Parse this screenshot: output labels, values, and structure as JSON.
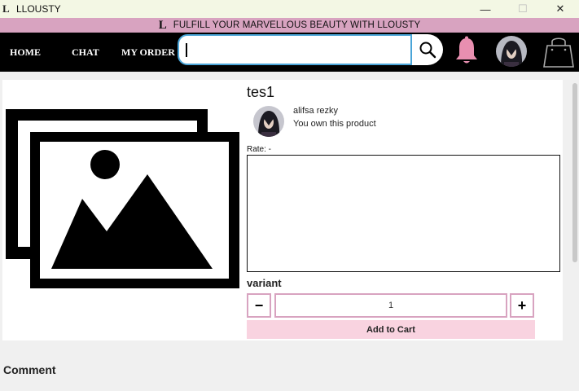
{
  "window": {
    "app_icon": "L",
    "title": "LLOUSTY",
    "minimize_glyph": "—",
    "maximize_glyph": "☐",
    "close_glyph": "✕"
  },
  "banner": {
    "logo": "L",
    "slogan": "FULFILL YOUR MARVELLOUS BEAUTY WITH LLOUSTY",
    "color": "#d8a3c0"
  },
  "nav": {
    "home": "HOME",
    "chat": "CHAT",
    "my_order": "MY ORDER",
    "search_value": "",
    "search_icon": "search-icon",
    "bell_icon": "bell-icon",
    "bell_color": "#e88fb0",
    "avatar": "user-avatar",
    "bag_icon": "shopping-bag-icon"
  },
  "product": {
    "title": "tes1",
    "image_icon": "image-placeholder-icon",
    "seller_name": "alifsa rezky",
    "seller_status": "You own this product",
    "rate_label": "Rate: -",
    "description": "",
    "variant_label": "variant",
    "quantity": "1",
    "minus_label": "−",
    "plus_label": "+",
    "add_to_cart_label": "Add to Cart"
  },
  "comments": {
    "heading": "Comment"
  },
  "colors": {
    "accent_pink": "#d8a3c0",
    "cart_pink": "#f9d3e0",
    "search_border": "#4aa5d8"
  }
}
